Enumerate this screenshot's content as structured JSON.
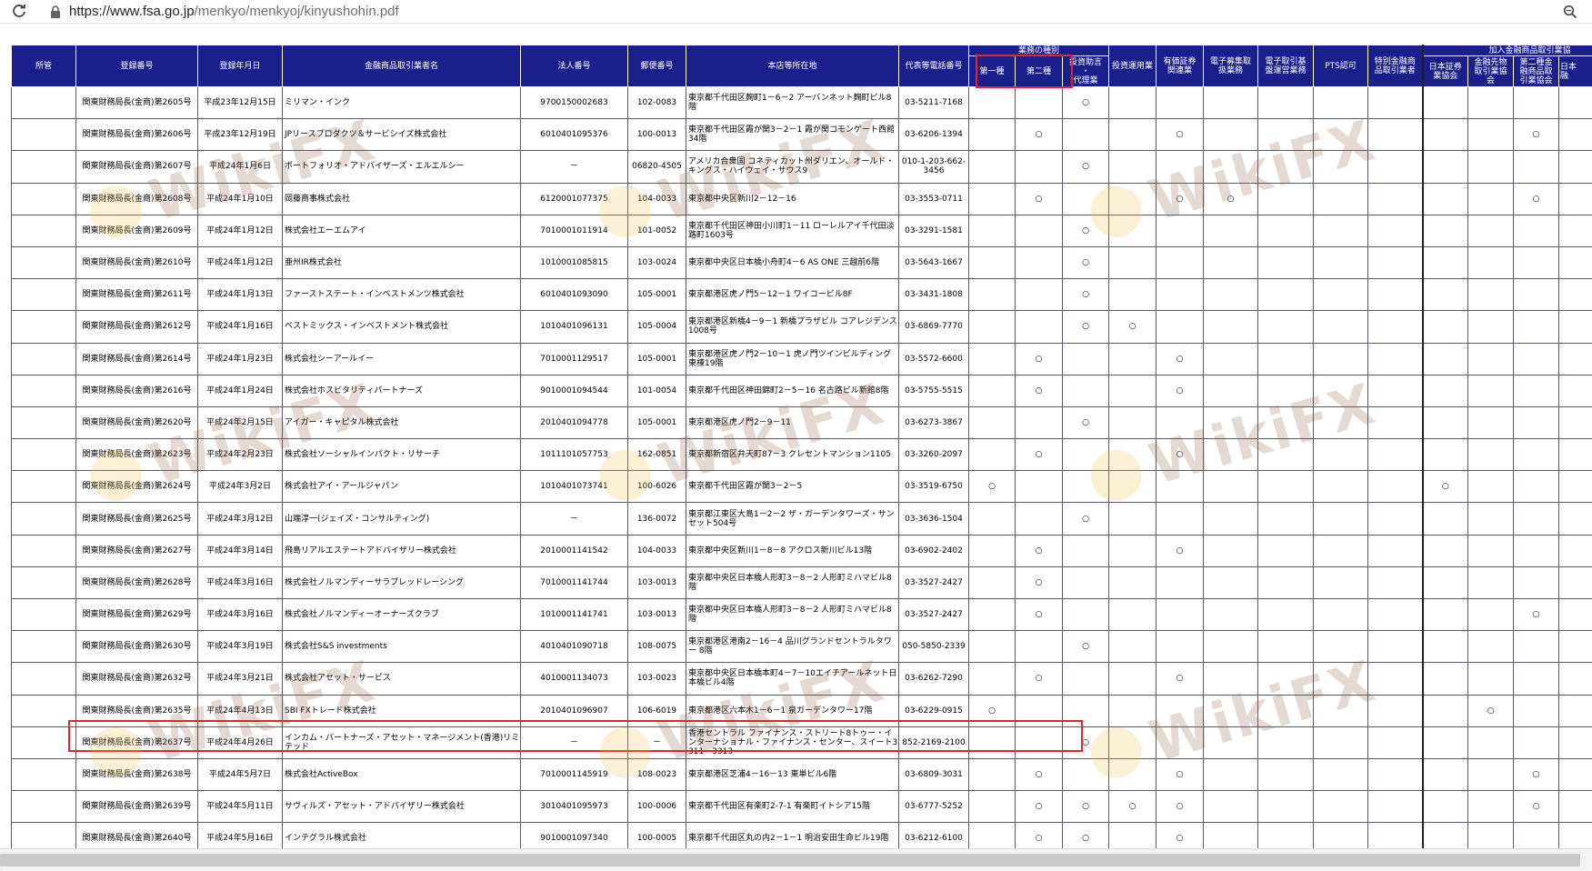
{
  "browser": {
    "url_host": "https://www.fsa.go.jp",
    "url_path": "/menkyo/menkyoj/kinyushohin.pdf",
    "reload_icon": "reload-icon",
    "lock_icon": "lock-icon",
    "zoom_icon": "zoom-icon"
  },
  "table": {
    "headers": {
      "shokan": "所管",
      "number": "登録番号",
      "date": "登録年月日",
      "name": "金融商品取引業者名",
      "corp": "法人番号",
      "postal": "郵便番号",
      "address": "本店等所在地",
      "phone": "代表等電話番号",
      "biz_group": "業務の種別",
      "type1": "第一種",
      "type2": "第二種",
      "advisory": "投資助言\n・\n代理業",
      "investment_mgmt": "投資運用業",
      "securities_related": "有価証券\n関連業",
      "ecom_offering": "電子募集取\n扱業務",
      "ecom_trading": "電子取引基\n盤運営業務",
      "pts": "PTS認可",
      "special": "特別金融商\n品取引業者",
      "assoc_group": "加入金融商品取引業協",
      "jsda": "日本証券\n業協会",
      "ffaj": "金融先物\n取引業協\n会",
      "type2_assoc": "第二種金\n融商品取\n引業協会",
      "last_partial": "日本\n融"
    },
    "rows": [
      {
        "shokan": "",
        "number": "関東財務局長(金商)第2605号",
        "date": "平成23年12月15日",
        "name": "ミリマン・インク",
        "corp": "9700150002683",
        "postal": "102-0083",
        "address": "東京都千代田区麹町1－6－2 アーバンネット麹町ビル8階",
        "phone": "03-5211-7168",
        "m": [
          "",
          "",
          "○",
          "",
          "",
          "",
          "",
          "",
          "",
          "",
          "",
          "",
          ""
        ]
      },
      {
        "shokan": "",
        "number": "関東財務局長(金商)第2606号",
        "date": "平成23年12月19日",
        "name": "JPリースプロダクツ＆サービシイズ株式会社",
        "corp": "6010401095376",
        "postal": "100-0013",
        "address": "東京都千代田区霞が関3－2－1 霞が関コモンゲート西館34階",
        "phone": "03-6206-1394",
        "m": [
          "",
          "○",
          "",
          "",
          "○",
          "",
          "",
          "",
          "",
          "",
          "",
          "○",
          ""
        ]
      },
      {
        "shokan": "",
        "number": "関東財務局長(金商)第2607号",
        "date": "平成24年1月6日",
        "name": "ポートフォリオ・アドバイザーズ・エルエルシー",
        "corp": "－",
        "postal": "06820-4505",
        "address": "アメリカ合衆国 コネティカット州ダリエン、オールド・キングス・ハイウェイ・サウス9",
        "phone": "010-1-203-662-3456",
        "m": [
          "",
          "",
          "○",
          "",
          "",
          "",
          "",
          "",
          "",
          "",
          "",
          "",
          ""
        ]
      },
      {
        "shokan": "",
        "number": "関東財務局長(金商)第2608号",
        "date": "平成24年1月10日",
        "name": "岡藤商事株式会社",
        "corp": "6120001077375",
        "postal": "104-0033",
        "address": "東京都中央区新川2－12－16",
        "phone": "03-3553-0711",
        "m": [
          "",
          "○",
          "",
          "",
          "○",
          "○",
          "",
          "",
          "",
          "",
          "",
          "○",
          ""
        ]
      },
      {
        "shokan": "",
        "number": "関東財務局長(金商)第2609号",
        "date": "平成24年1月12日",
        "name": "株式会社エーエムアイ",
        "corp": "7010001011914",
        "postal": "101-0052",
        "address": "東京都千代田区神田小川町1－11 ローレルアイ千代田淡路町1603号",
        "phone": "03-3291-1581",
        "m": [
          "",
          "",
          "○",
          "",
          "",
          "",
          "",
          "",
          "",
          "",
          "",
          "",
          ""
        ]
      },
      {
        "shokan": "",
        "number": "関東財務局長(金商)第2610号",
        "date": "平成24年1月12日",
        "name": "亜州IR株式会社",
        "corp": "1010001085815",
        "postal": "103-0024",
        "address": "東京都中央区日本橋小舟町4－6 AS ONE 三越前6階",
        "phone": "03-5643-1667",
        "m": [
          "",
          "",
          "○",
          "",
          "",
          "",
          "",
          "",
          "",
          "",
          "",
          "",
          ""
        ]
      },
      {
        "shokan": "",
        "number": "関東財務局長(金商)第2611号",
        "date": "平成24年1月13日",
        "name": "ファーストステート・インベストメンツ株式会社",
        "corp": "6010401093090",
        "postal": "105-0001",
        "address": "東京都港区虎ノ門5－12－1 ワイコービル8F",
        "phone": "03-3431-1808",
        "m": [
          "",
          "",
          "○",
          "",
          "",
          "",
          "",
          "",
          "",
          "",
          "",
          "",
          ""
        ]
      },
      {
        "shokan": "",
        "number": "関東財務局長(金商)第2612号",
        "date": "平成24年1月16日",
        "name": "ベストミックス・インベストメント株式会社",
        "corp": "1010401096131",
        "postal": "105-0004",
        "address": "東京都港区新橋4－9－1 新橋プラザビル コアレジデンス1008号",
        "phone": "03-6869-7770",
        "m": [
          "",
          "",
          "○",
          "○",
          "",
          "",
          "",
          "",
          "",
          "",
          "",
          "",
          ""
        ]
      },
      {
        "shokan": "",
        "number": "関東財務局長(金商)第2614号",
        "date": "平成24年1月23日",
        "name": "株式会社シーアールイー",
        "corp": "7010001129517",
        "postal": "105-0001",
        "address": "東京都港区虎ノ門2－10－1 虎ノ門ツインビルディング東棟19階",
        "phone": "03-5572-6600",
        "m": [
          "",
          "○",
          "",
          "",
          "○",
          "",
          "",
          "",
          "",
          "",
          "",
          "",
          ""
        ]
      },
      {
        "shokan": "",
        "number": "関東財務局長(金商)第2616号",
        "date": "平成24年1月24日",
        "name": "株式会社ホスピタリティパートナーズ",
        "corp": "9010001094544",
        "postal": "101-0054",
        "address": "東京都千代田区神田錦町2－5－16 名古路ビル新館8階",
        "phone": "03-5755-5515",
        "m": [
          "",
          "○",
          "",
          "",
          "○",
          "",
          "",
          "",
          "",
          "",
          "",
          "",
          ""
        ]
      },
      {
        "shokan": "",
        "number": "関東財務局長(金商)第2620号",
        "date": "平成24年2月15日",
        "name": "アイガー・キャピタル株式会社",
        "corp": "2010401094778",
        "postal": "105-0001",
        "address": "東京都港区虎ノ門2－9－11",
        "phone": "03-6273-3867",
        "m": [
          "",
          "",
          "○",
          "",
          "",
          "",
          "",
          "",
          "",
          "",
          "",
          "",
          ""
        ]
      },
      {
        "shokan": "",
        "number": "関東財務局長(金商)第2623号",
        "date": "平成24年2月23日",
        "name": "株式会社ソーシャルインパクト・リサーチ",
        "corp": "1011101057753",
        "postal": "162-0851",
        "address": "東京都新宿区弁天町87－3 クレセントマンション1105",
        "phone": "03-3260-2097",
        "m": [
          "",
          "○",
          "",
          "",
          "○",
          "",
          "",
          "",
          "",
          "",
          "",
          "",
          ""
        ]
      },
      {
        "shokan": "",
        "number": "関東財務局長(金商)第2624号",
        "date": "平成24年3月2日",
        "name": "株式会社アイ・アールジャパン",
        "corp": "1010401073741",
        "postal": "100-6026",
        "address": "東京都千代田区霞が関3－2－5",
        "phone": "03-3519-6750",
        "m": [
          "○",
          "",
          "",
          "",
          "",
          "",
          "",
          "",
          "",
          "○",
          "",
          "",
          ""
        ]
      },
      {
        "shokan": "",
        "number": "関東財務局長(金商)第2625号",
        "date": "平成24年3月12日",
        "name": "山端淳一(ジェイズ・コンサルティング)",
        "corp": "－",
        "postal": "136-0072",
        "address": "東京都江東区大島1－2－2 ザ・ガーデンタワーズ・サンセット504号",
        "phone": "03-3636-1504",
        "m": [
          "",
          "",
          "○",
          "",
          "",
          "",
          "",
          "",
          "",
          "",
          "",
          "",
          ""
        ]
      },
      {
        "shokan": "",
        "number": "関東財務局長(金商)第2627号",
        "date": "平成24年3月14日",
        "name": "飛島リアルエステートアドバイザリー株式会社",
        "corp": "2010001141542",
        "postal": "104-0033",
        "address": "東京都中央区新川1－8－8 アクロス新川ビル13階",
        "phone": "03-6902-2402",
        "m": [
          "",
          "○",
          "",
          "",
          "○",
          "",
          "",
          "",
          "",
          "",
          "",
          "",
          ""
        ]
      },
      {
        "shokan": "",
        "number": "関東財務局長(金商)第2628号",
        "date": "平成24年3月16日",
        "name": "株式会社ノルマンディーサラブレッドレーシング",
        "corp": "7010001141744",
        "postal": "103-0013",
        "address": "東京都中央区日本橋人形町3－8－2 人形町ミハマビル8階",
        "phone": "03-3527-2427",
        "m": [
          "",
          "○",
          "",
          "",
          "",
          "",
          "",
          "",
          "",
          "",
          "",
          "",
          ""
        ]
      },
      {
        "shokan": "",
        "number": "関東財務局長(金商)第2629号",
        "date": "平成24年3月16日",
        "name": "株式会社ノルマンディーオーナーズクラブ",
        "corp": "1010001141741",
        "postal": "103-0013",
        "address": "東京都中央区日本橋人形町3－8－2 人形町ミハマビル8階",
        "phone": "03-3527-2427",
        "m": [
          "",
          "○",
          "",
          "",
          "",
          "",
          "",
          "",
          "",
          "",
          "",
          "○",
          ""
        ]
      },
      {
        "shokan": "",
        "number": "関東財務局長(金商)第2630号",
        "date": "平成24年3月19日",
        "name": "株式会社S&S investments",
        "corp": "4010401090718",
        "postal": "108-0075",
        "address": "東京都港区港南2－16－4 品川グランドセントラルタワー 8階",
        "phone": "050-5850-2339",
        "m": [
          "",
          "",
          "○",
          "",
          "",
          "",
          "",
          "",
          "",
          "",
          "",
          "",
          ""
        ]
      },
      {
        "shokan": "",
        "number": "関東財務局長(金商)第2632号",
        "date": "平成24年3月21日",
        "name": "株式会社アセット・サービス",
        "corp": "4010001134073",
        "postal": "103-0023",
        "address": "東京都中央区日本橋本町4－7－10エイチアールネット日本橋ビル4階",
        "phone": "03-6262-7290",
        "m": [
          "",
          "○",
          "",
          "",
          "○",
          "",
          "",
          "",
          "",
          "",
          "",
          "",
          ""
        ]
      },
      {
        "shokan": "",
        "number": "関東財務局長(金商)第2635号",
        "date": "平成24年4月13日",
        "name": "SBI FXトレード株式会社",
        "corp": "2010401096907",
        "postal": "106-6019",
        "address": "東京都港区六本木1－6－1 泉ガーデンタワー17階",
        "phone": "03-6229-0915",
        "m": [
          "○",
          "",
          "",
          "",
          "",
          "",
          "",
          "",
          "",
          "",
          "○",
          "",
          ""
        ]
      },
      {
        "shokan": "",
        "number": "関東財務局長(金商)第2637号",
        "date": "平成24年4月26日",
        "name": "インカム・パートナーズ・アセット・マネージメント(香港)リミテッド",
        "corp": "－",
        "postal": "－",
        "address": "香港セントラル ファイナンス・ストリート8トゥー・インターナショナル・ファイナンス・センター、スイート3311－3313",
        "phone": "852-2169-2100",
        "m": [
          "",
          "",
          "○",
          "",
          "",
          "",
          "",
          "",
          "",
          "",
          "",
          "",
          ""
        ]
      },
      {
        "shokan": "",
        "number": "関東財務局長(金商)第2638号",
        "date": "平成24年5月7日",
        "name": "株式会社ActiveBox",
        "corp": "7010001145919",
        "postal": "108-0023",
        "address": "東京都港区芝浦4－16－13 東単ビル6階",
        "phone": "03-6809-3031",
        "m": [
          "",
          "○",
          "",
          "",
          "○",
          "",
          "",
          "",
          "",
          "",
          "",
          "○",
          ""
        ]
      },
      {
        "shokan": "",
        "number": "関東財務局長(金商)第2639号",
        "date": "平成24年5月11日",
        "name": "サヴィルズ・アセット・アドバイザリー株式会社",
        "corp": "3010401095973",
        "postal": "100-0006",
        "address": "東京都千代田区有楽町2-7-1 有楽町イトシア15階",
        "phone": "03-6777-5252",
        "m": [
          "",
          "○",
          "○",
          "○",
          "○",
          "",
          "",
          "",
          "",
          "",
          "",
          "○",
          ""
        ]
      },
      {
        "shokan": "",
        "number": "関東財務局長(金商)第2640号",
        "date": "平成24年5月16日",
        "name": "インテグラル株式会社",
        "corp": "9010001097340",
        "postal": "100-0005",
        "address": "東京都千代田区丸の内2－1－1 明治安田生命ビル19階",
        "phone": "03-6212-6100",
        "m": [
          "",
          "○",
          "○",
          "",
          "○",
          "",
          "",
          "",
          "",
          "",
          "",
          "",
          ""
        ]
      }
    ]
  },
  "watermark": {
    "text": "WikiFX",
    "logo_icon": "wikifx-logo-icon"
  },
  "colors": {
    "header_bg": "#1b1f8c",
    "highlight": "#e0262f"
  }
}
